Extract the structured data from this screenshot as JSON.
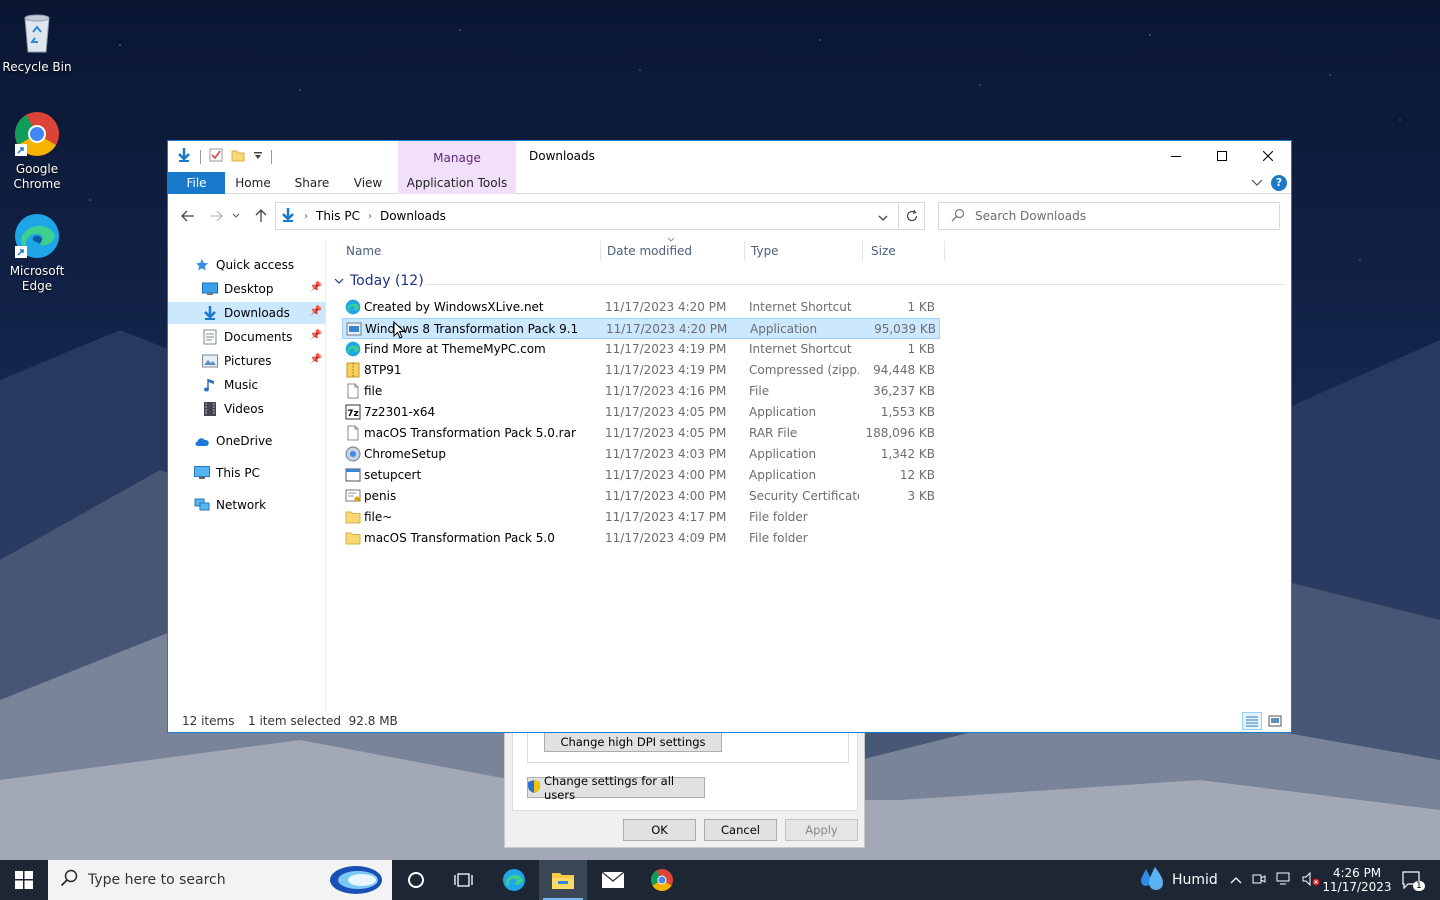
{
  "desktop": {
    "icons": [
      {
        "label": "Recycle Bin"
      },
      {
        "label": "Google Chrome"
      },
      {
        "label": "Microsoft Edge"
      }
    ]
  },
  "properties_dialog": {
    "dpi_button": "Change high DPI settings",
    "all_users_button": "Change settings for all users",
    "ok": "OK",
    "cancel": "Cancel",
    "apply": "Apply"
  },
  "explorer": {
    "title": "Downloads",
    "contextual_tab_group": "Manage",
    "ribbon_tabs": [
      "File",
      "Home",
      "Share",
      "View",
      "Application Tools"
    ],
    "breadcrumb": [
      "This PC",
      "Downloads"
    ],
    "search_placeholder": "Search Downloads",
    "nav": {
      "quick_access": "Quick access",
      "items": [
        "Desktop",
        "Downloads",
        "Documents",
        "Pictures",
        "Music",
        "Videos"
      ],
      "onedrive": "OneDrive",
      "this_pc": "This PC",
      "network": "Network"
    },
    "columns": [
      "Name",
      "Date modified",
      "Type",
      "Size"
    ],
    "group_header": "Today (12)",
    "files": [
      {
        "name": "Created by WindowsXLive.net",
        "date": "11/17/2023 4:20 PM",
        "type": "Internet Shortcut",
        "size": "1 KB",
        "icon": "edge-shortcut-icon"
      },
      {
        "name": "Windows 8 Transformation Pack 9.1",
        "date": "11/17/2023 4:20 PM",
        "type": "Application",
        "size": "95,039 KB",
        "icon": "installer-icon"
      },
      {
        "name": "Find More at ThemeMyPC.com",
        "date": "11/17/2023 4:19 PM",
        "type": "Internet Shortcut",
        "size": "1 KB",
        "icon": "edge-shortcut-icon"
      },
      {
        "name": "8TP91",
        "date": "11/17/2023 4:19 PM",
        "type": "Compressed (zipp...",
        "size": "94,448 KB",
        "icon": "zip-icon"
      },
      {
        "name": "file",
        "date": "11/17/2023 4:16 PM",
        "type": "File",
        "size": "36,237 KB",
        "icon": "blank-file-icon"
      },
      {
        "name": "7z2301-x64",
        "date": "11/17/2023 4:05 PM",
        "type": "Application",
        "size": "1,553 KB",
        "icon": "7zip-icon"
      },
      {
        "name": "macOS Transformation Pack 5.0.rar",
        "date": "11/17/2023 4:05 PM",
        "type": "RAR File",
        "size": "188,096 KB",
        "icon": "blank-file-icon"
      },
      {
        "name": "ChromeSetup",
        "date": "11/17/2023 4:03 PM",
        "type": "Application",
        "size": "1,342 KB",
        "icon": "chrome-setup-icon"
      },
      {
        "name": "setupcert",
        "date": "11/17/2023 4:00 PM",
        "type": "Application",
        "size": "12 KB",
        "icon": "app-window-icon"
      },
      {
        "name": "penis",
        "date": "11/17/2023 4:00 PM",
        "type": "Security Certificate",
        "size": "3 KB",
        "icon": "certificate-icon"
      },
      {
        "name": "file~",
        "date": "11/17/2023 4:17 PM",
        "type": "File folder",
        "size": "",
        "icon": "folder-icon"
      },
      {
        "name": "macOS Transformation Pack 5.0",
        "date": "11/17/2023 4:09 PM",
        "type": "File folder",
        "size": "",
        "icon": "folder-icon"
      }
    ],
    "selected_index": 1,
    "status": {
      "count": "12 items",
      "selection": "1 item selected  92.8 MB"
    }
  },
  "taskbar": {
    "search_placeholder": "Type here to search",
    "weather": "Humid",
    "time": "4:26 PM",
    "date": "11/17/2023",
    "notification_count": "1"
  },
  "colors": {
    "accent": "#1979ca",
    "selection": "#cce8ff",
    "manage_tab": "#f2e0fa",
    "taskbar": "#1d2633"
  }
}
